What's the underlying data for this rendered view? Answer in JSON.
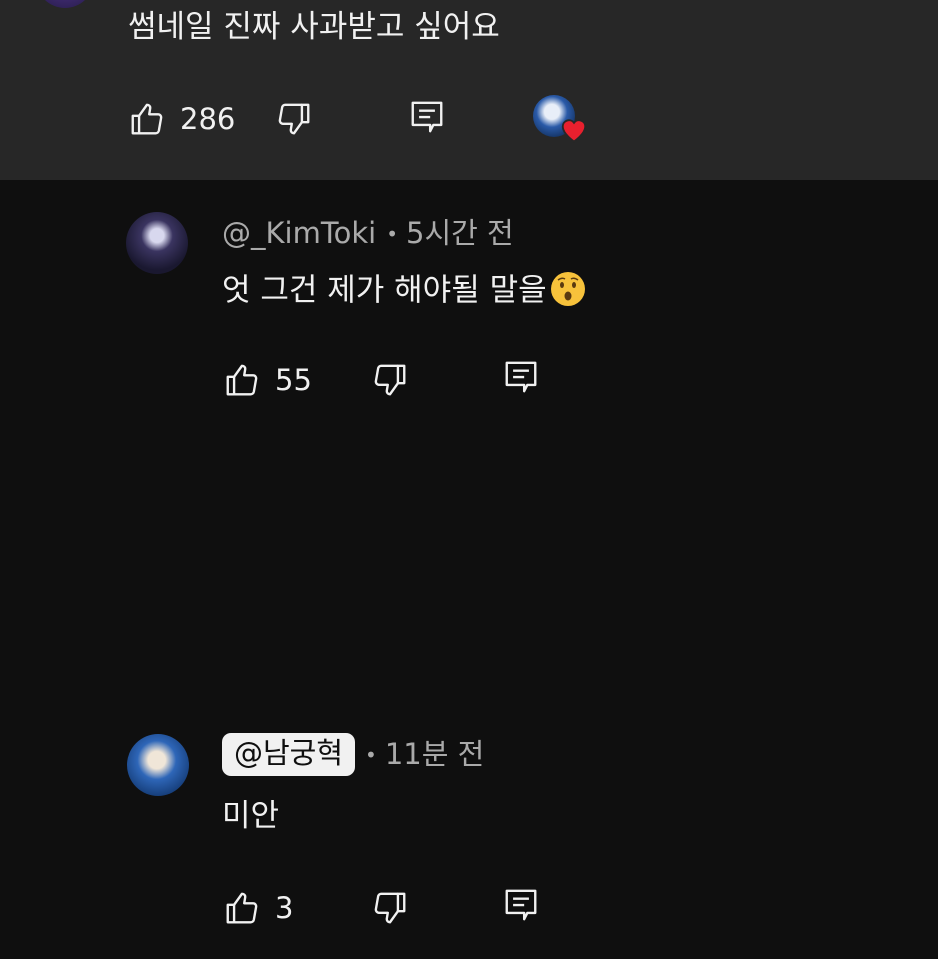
{
  "comment_top": {
    "text": "썸네일 진짜 사과받고 싶어요",
    "likes": "286"
  },
  "reply_1": {
    "handle": "@_KimToki",
    "time": "5시간 전",
    "text": "엇 그건 제가 해야될 말을",
    "emoji": "hushed-face-emoji",
    "likes": "55"
  },
  "reply_2": {
    "handle": "@남궁혁",
    "time": "11분 전",
    "text": "미안",
    "likes": "3"
  },
  "colors": {
    "background": "#0f0f0f",
    "highlight_background": "#272727",
    "text": "#f1f1f1",
    "secondary_text": "#aaaaaa",
    "heart": "#e8202e"
  },
  "icons": [
    "like-icon",
    "dislike-icon",
    "reply-icon",
    "creator-heart-icon"
  ]
}
